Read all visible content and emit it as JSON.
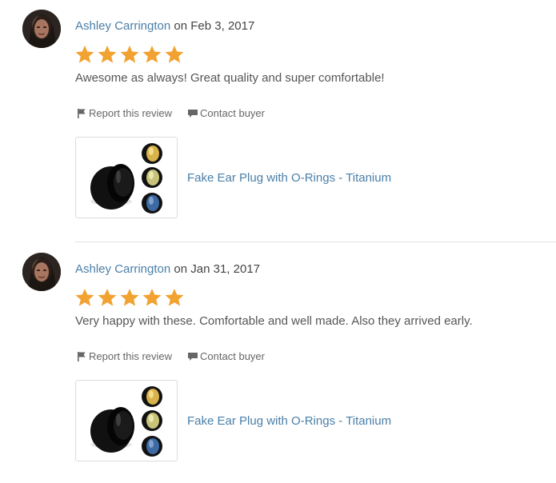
{
  "reviews": [
    {
      "reviewer": "Ashley Carrington",
      "on_text": "on",
      "date": "Feb 3, 2017",
      "rating": 5,
      "text": "Awesome as always! Great quality and super comfortable!",
      "actions": {
        "report": "Report this review",
        "contact": "Contact buyer"
      },
      "product": {
        "title": "Fake Ear Plug with O-Rings - Titanium"
      }
    },
    {
      "reviewer": "Ashley Carrington",
      "on_text": "on",
      "date": "Jan 31, 2017",
      "rating": 5,
      "text": "Very happy with these. Comfortable and well made. Also they arrived early.",
      "actions": {
        "report": "Report this review",
        "contact": "Contact buyer"
      },
      "product": {
        "title": "Fake Ear Plug with O-Rings - Titanium"
      }
    }
  ],
  "colors": {
    "link": "#4a7fa8",
    "star": "#f2a230",
    "divider": "#e1e1e1"
  },
  "icons": [
    "flag-icon",
    "chat-icon",
    "star-icon"
  ]
}
